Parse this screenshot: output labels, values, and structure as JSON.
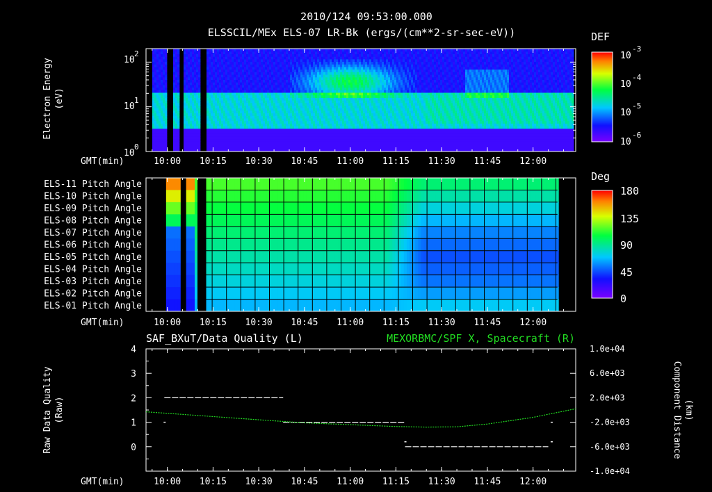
{
  "header": {
    "line1": "2010/124 09:53:00.000",
    "line2": "ELSSCIL/MEx ELS-07 LR-Bk  (ergs/(cm**2-sr-sec-eV))"
  },
  "time_axis": {
    "label": "GMT(min)",
    "ticks": [
      "10:00",
      "10:15",
      "10:30",
      "10:45",
      "11:00",
      "11:15",
      "11:30",
      "11:45",
      "12:00"
    ]
  },
  "chart_data": [
    {
      "type": "heatmap",
      "ylabel": "Electron Energy (eV)",
      "ylabel_lines": [
        "Electron Energy",
        "(eV)"
      ],
      "yscale": "log",
      "ylim": [
        1,
        200
      ],
      "yticks": [
        "10",
        "10",
        "10"
      ],
      "ytick_exponents": [
        "2",
        "1",
        "0"
      ],
      "colorbar": {
        "label": "DEF",
        "ticks": [
          "10",
          "10",
          "10",
          "10"
        ],
        "exponents": [
          "-3",
          "-4",
          "-5",
          "-6"
        ],
        "range": [
          1e-06,
          0.001
        ],
        "scale": "log"
      },
      "data_gaps": [
        "10:00",
        "10:04",
        "10:11"
      ],
      "features": {
        "background": "blue/purple at >20 eV, cyan band 4-20 eV",
        "peak_region": "green/yellow 20-100 eV from 10:45 to 11:20"
      }
    },
    {
      "type": "heatmap",
      "rows": [
        "ELS-11 Pitch Angle",
        "ELS-10 Pitch Angle",
        "ELS-09 Pitch Angle",
        "ELS-08 Pitch Angle",
        "ELS-07 Pitch Angle",
        "ELS-06 Pitch Angle",
        "ELS-05 Pitch Angle",
        "ELS-04 Pitch Angle",
        "ELS-03 Pitch Angle",
        "ELS-02 Pitch Angle",
        "ELS-01 Pitch Angle"
      ],
      "colorbar": {
        "label": "Deg",
        "ticks": [
          "180",
          "135",
          "90",
          "45",
          "0"
        ],
        "range": [
          0,
          180
        ]
      },
      "pitch_angle_before_1118_deg": [
        115,
        110,
        105,
        100,
        95,
        90,
        85,
        80,
        75,
        70,
        65
      ],
      "pitch_angle_after_1118_deg": [
        95,
        85,
        75,
        65,
        55,
        50,
        45,
        48,
        52,
        60,
        70
      ]
    },
    {
      "type": "line",
      "title_left": "SAF_BXuT/Data Quality (L)",
      "title_right": "MEXORBMC/SPF X, Spacecraft (R)",
      "ylabel_left_lines": [
        "Raw Data Quality",
        "(Raw)"
      ],
      "ylabel_right_lines": [
        "Component Distance",
        "(km)"
      ],
      "ylim_left": [
        -1,
        4
      ],
      "yticks_left": [
        "4",
        "3",
        "2",
        "1",
        "0"
      ],
      "ylim_right": [
        -10000,
        10000
      ],
      "yticks_right": [
        "1.0e+04",
        "6.0e+03",
        "2.0e+03",
        "-2.0e+03",
        "-6.0e+03",
        "-1.0e+04"
      ],
      "series": [
        {
          "name": "SAF_BXuT/Data Quality",
          "color": "#ffffff",
          "segments": [
            {
              "x": [
                "09:59",
                "10:38"
              ],
              "y": 2
            },
            {
              "x": [
                "10:38",
                "11:18"
              ],
              "y": 1
            },
            {
              "x": [
                "11:18",
                "12:05"
              ],
              "y": 0
            }
          ],
          "points": [
            {
              "x": "09:59",
              "y": 1
            },
            {
              "x": "11:18",
              "y": 0.2
            },
            {
              "x": "12:06",
              "y": 0.2
            },
            {
              "x": "12:06",
              "y": 1
            }
          ]
        },
        {
          "name": "MEXORBMC/SPF X, Spacecraft",
          "color": "#22dd22",
          "x": [
            "09:53",
            "10:10",
            "10:30",
            "10:45",
            "11:00",
            "11:15",
            "11:25",
            "11:35",
            "11:45",
            "12:00",
            "12:14"
          ],
          "y_km": [
            -300,
            -900,
            -1600,
            -2100,
            -2400,
            -2700,
            -2800,
            -2750,
            -2300,
            -1200,
            200
          ]
        }
      ]
    }
  ]
}
